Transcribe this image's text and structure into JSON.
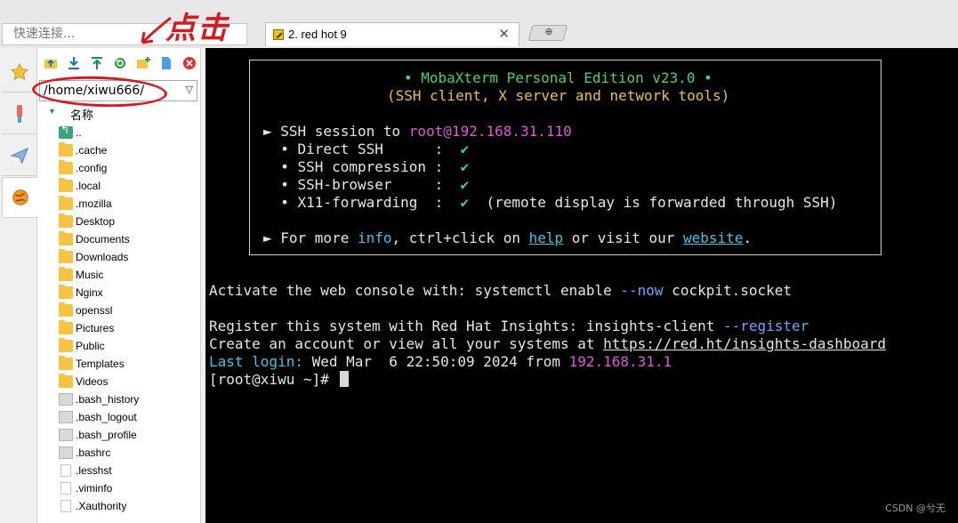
{
  "toolbar": {
    "quick_connect_placeholder": "快速连接..."
  },
  "tabs": [
    {
      "label": "2. red hot 9",
      "close": "✕"
    }
  ],
  "new_tab_symbol": "⊕",
  "sftp": {
    "path": "/home/xiwu666/",
    "column_name": "名称",
    "items": [
      {
        "name": "..",
        "type": "parent"
      },
      {
        "name": ".cache",
        "type": "folder"
      },
      {
        "name": ".config",
        "type": "folder"
      },
      {
        "name": ".local",
        "type": "folder"
      },
      {
        "name": ".mozilla",
        "type": "folder"
      },
      {
        "name": "Desktop",
        "type": "folder"
      },
      {
        "name": "Documents",
        "type": "folder"
      },
      {
        "name": "Downloads",
        "type": "folder"
      },
      {
        "name": "Music",
        "type": "folder"
      },
      {
        "name": "Nginx",
        "type": "folder"
      },
      {
        "name": "openssl",
        "type": "folder"
      },
      {
        "name": "Pictures",
        "type": "folder"
      },
      {
        "name": "Public",
        "type": "folder"
      },
      {
        "name": "Templates",
        "type": "folder"
      },
      {
        "name": "Videos",
        "type": "folder"
      },
      {
        "name": ".bash_history",
        "type": "doc"
      },
      {
        "name": ".bash_logout",
        "type": "doc"
      },
      {
        "name": ".bash_profile",
        "type": "doc"
      },
      {
        "name": ".bashrc",
        "type": "doc"
      },
      {
        "name": ".lesshst",
        "type": "text"
      },
      {
        "name": ".viminfo",
        "type": "text"
      },
      {
        "name": ".Xauthority",
        "type": "text"
      }
    ]
  },
  "terminal": {
    "banner_title": "• MobaXterm Personal Edition v23.0 •",
    "banner_subtitle": "(SSH client, X server and network tools)",
    "session_prefix": "► SSH session to ",
    "session_host": "root@192.168.31.110",
    "features": [
      {
        "label": "  • Direct SSH      :  ",
        "check": "✔",
        "note": ""
      },
      {
        "label": "  • SSH compression :  ",
        "check": "✔",
        "note": ""
      },
      {
        "label": "  • SSH-browser     :  ",
        "check": "✔",
        "note": ""
      },
      {
        "label": "  • X11-forwarding  :  ",
        "check": "✔",
        "note": "  (remote display is forwarded through SSH)"
      }
    ],
    "more_prefix": "► For more ",
    "more_info": "info",
    "more_mid": ", ctrl+click on ",
    "more_help": "help",
    "more_or": " or visit our ",
    "more_website": "website",
    "more_end": ".",
    "cockpit_prefix": "Activate the web console with: systemctl enable ",
    "cockpit_flag": "--now",
    "cockpit_suffix": " cockpit.socket",
    "insights_prefix": "Register this system with Red Hat Insights: insights-client ",
    "insights_flag": "--register",
    "account_prefix": "Create an account or view all your systems at ",
    "account_url": "https://red.ht/insights-dashboard",
    "last_login_label": "Last login:",
    "last_login_date": " Wed Mar  6 22:50:09 2024 from ",
    "last_login_ip": "192.168.31.1",
    "prompt": "[root@xiwu ~]# "
  },
  "annotation": {
    "text": "点击"
  },
  "watermark": "CSDN @兮无",
  "colors": {
    "terminal_bg": "#000000",
    "green": "#44d37b",
    "yellow": "#f0c040",
    "magenta": "#e057d9",
    "cyan": "#3ec6e6",
    "annotation_red": "#d8191f"
  }
}
